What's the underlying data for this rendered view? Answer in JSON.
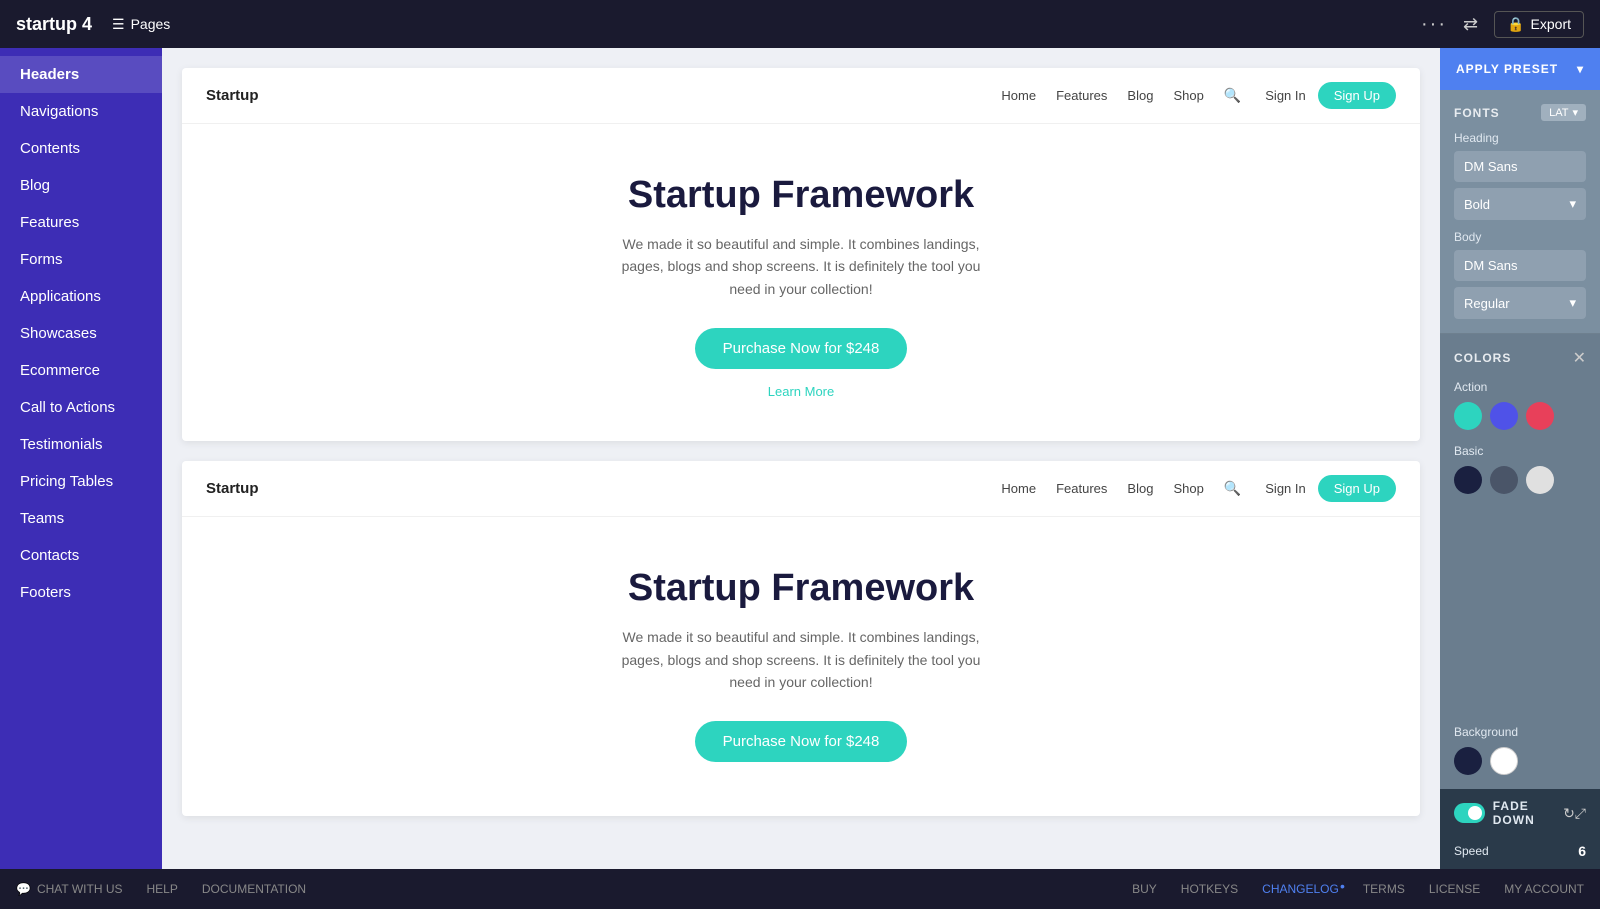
{
  "app": {
    "brand": "startup 4",
    "pages_label": "Pages",
    "export_label": "Export"
  },
  "sidebar": {
    "items": [
      {
        "id": "headers",
        "label": "Headers",
        "active": true
      },
      {
        "id": "navigations",
        "label": "Navigations"
      },
      {
        "id": "contents",
        "label": "Contents"
      },
      {
        "id": "blog",
        "label": "Blog"
      },
      {
        "id": "features",
        "label": "Features"
      },
      {
        "id": "forms",
        "label": "Forms"
      },
      {
        "id": "applications",
        "label": "Applications"
      },
      {
        "id": "showcases",
        "label": "Showcases"
      },
      {
        "id": "ecommerce",
        "label": "Ecommerce"
      },
      {
        "id": "call-to-actions",
        "label": "Call to Actions"
      },
      {
        "id": "testimonials",
        "label": "Testimonials"
      },
      {
        "id": "pricing-tables",
        "label": "Pricing Tables"
      },
      {
        "id": "teams",
        "label": "Teams"
      },
      {
        "id": "contacts",
        "label": "Contacts"
      },
      {
        "id": "footers",
        "label": "Footers"
      }
    ]
  },
  "preview": {
    "card1": {
      "brand": "Startup",
      "nav_links": [
        "Home",
        "Features",
        "Blog",
        "Shop"
      ],
      "signin": "Sign In",
      "signup": "Sign Up",
      "heading": "Startup Framework",
      "body": "We made it so beautiful and simple. It combines landings, pages, blogs and shop screens. It is definitely the tool you need in your collection!",
      "cta": "Purchase Now for $248",
      "learn_more": "Learn More"
    },
    "card2": {
      "brand": "Startup",
      "nav_links": [
        "Home",
        "Features",
        "Blog",
        "Shop"
      ],
      "signin": "Sign In",
      "signup": "Sign Up",
      "heading": "Startup Framework",
      "body": "We made it so beautiful and simple. It combines landings, pages, blogs and shop screens. It is definitely the tool you need in your collection!",
      "cta": "Purchase Now for $248"
    }
  },
  "right_panel": {
    "apply_preset_label": "APPLY PRESET",
    "fonts_label": "FONTS",
    "lang_badge": "LAT",
    "heading_label": "Heading",
    "heading_font": "DM Sans",
    "heading_weight": "Bold",
    "body_label": "Body",
    "body_font": "DM Sans",
    "body_weight": "Regular",
    "colors_label": "COLORS",
    "action_label": "Action",
    "action_colors": [
      "#2dd4bf",
      "#4f52e8",
      "#e8405a"
    ],
    "basic_label": "Basic",
    "basic_colors": [
      "#1a2040",
      "#4a5568",
      "#e0e0e0"
    ],
    "background_label": "Background",
    "background_colors": [
      "#1a2040",
      "#ffffff"
    ],
    "fade_label": "FADE DOWN",
    "fade_active": true,
    "speed_label": "Speed",
    "speed_value": "6"
  },
  "bottom_bar": {
    "chat_label": "CHAT WITH US",
    "help_label": "HELP",
    "documentation_label": "DOCUMENTATION",
    "buy_label": "BUY",
    "hotkeys_label": "HOTKEYS",
    "changelog_label": "CHANGELOG",
    "terms_label": "TERMS",
    "license_label": "LICENSE",
    "my_account_label": "MY ACCOUNT"
  }
}
